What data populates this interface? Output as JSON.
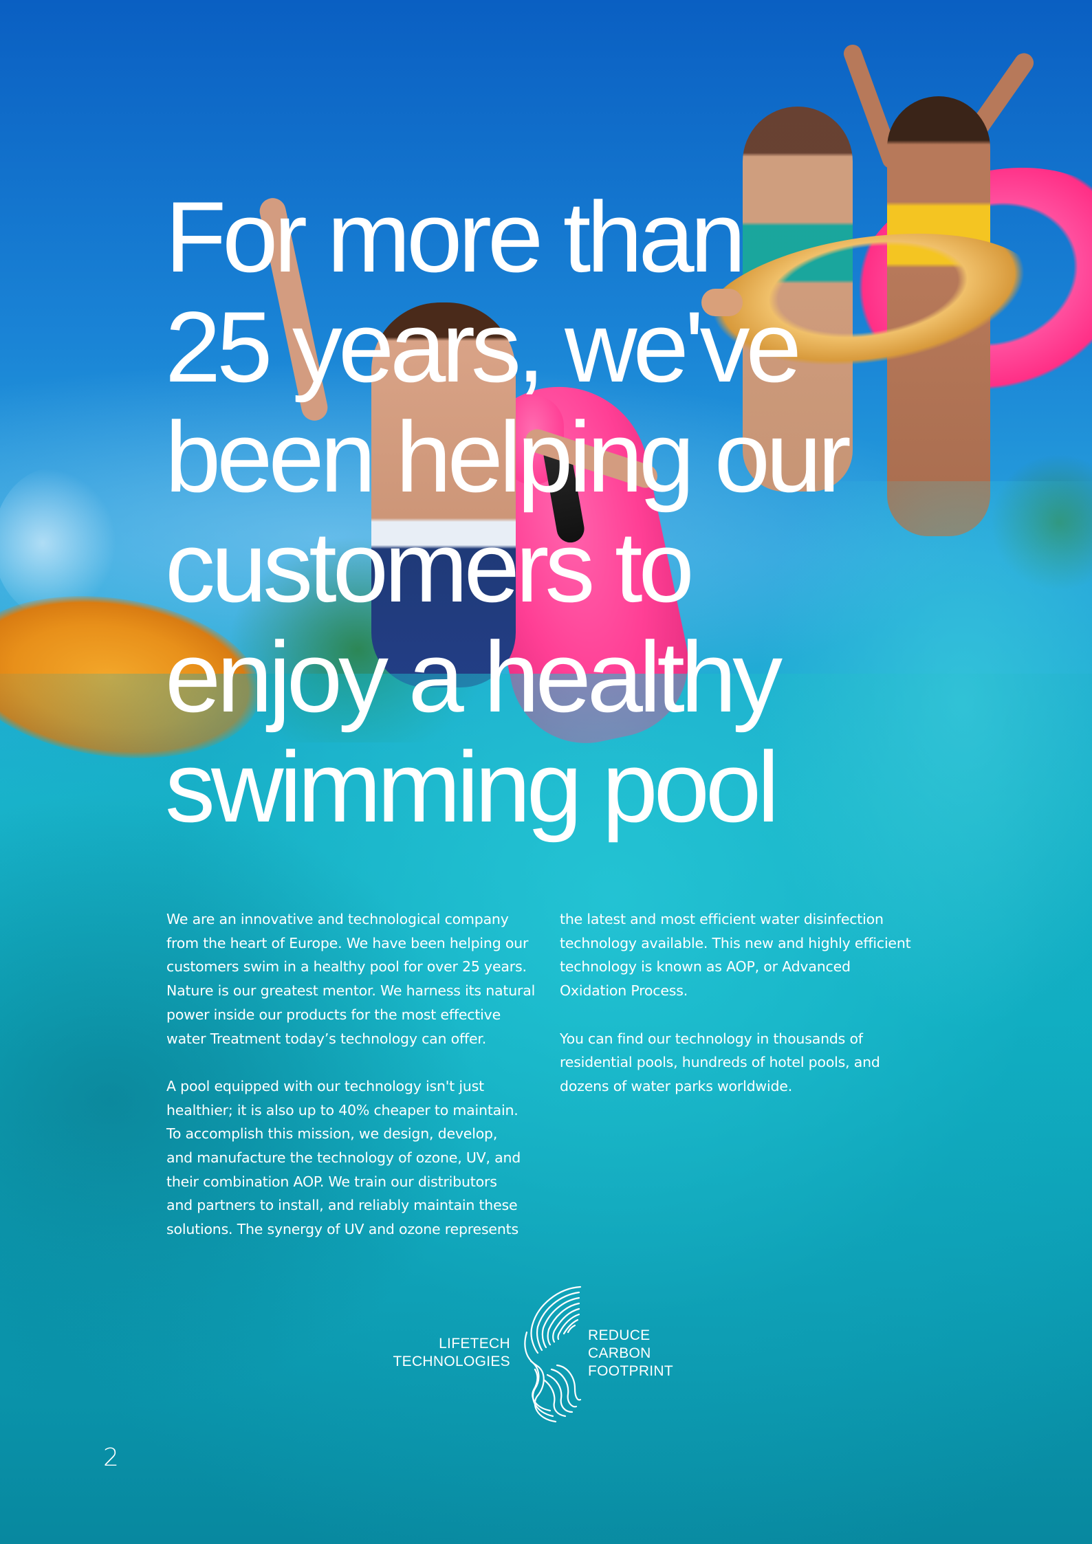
{
  "headline": {
    "lines": [
      "For more than",
      "25 years, we've",
      "been helping our",
      "customers to",
      "enjoy a healthy",
      "swimming pool"
    ]
  },
  "body": {
    "left_column": [
      "We are an innovative and technological company\nfrom the heart of Europe. We have been helping our\ncustomers swim in a healthy pool for over 25 years.\nNature is our greatest mentor. We harness its natural\npower inside our products for the most effective\nwater Treatment today’s technology can offer.",
      "A pool equipped with our technology isn't just\nhealthier; it is also up to 40% cheaper to maintain.\nTo accomplish this mission, we design, develop,\nand manufacture the technology of ozone, UV, and\ntheir combination AOP. We train our distributors\nand partners to install, and reliably maintain these\nsolutions. The synergy of UV and ozone represents"
    ],
    "right_column": [
      "the latest and most efficient water disinfection\ntechnology available. This new and highly efficient\ntechnology is known as AOP, or Advanced\nOxidation Process.",
      "You can find our technology in thousands of\nresidential pools, hundreds of hotel pools, and\ndozens of water parks worldwide."
    ]
  },
  "logo": {
    "left_lines": [
      "LIFETECH",
      "TECHNOLOGIES"
    ],
    "right_lines": [
      "REDUCE",
      "CARBON",
      "FOOTPRINT"
    ],
    "icon": "wave-drop-icon"
  },
  "page_number": "2",
  "colors": {
    "text": "#ffffff",
    "sky": "#0a5fc2",
    "water": "#19b4cc",
    "water_deep": "#08889f"
  }
}
